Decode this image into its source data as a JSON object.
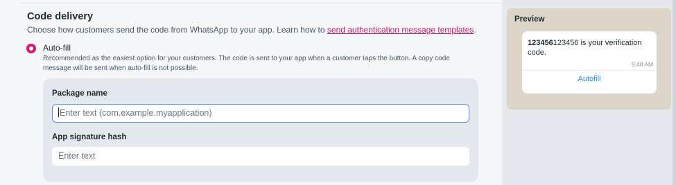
{
  "section": {
    "title": "Code delivery",
    "desc_prefix": "Choose how customers send the code from WhatsApp to your app. Learn how to ",
    "desc_link": "send authentication message templates",
    "desc_suffix": "."
  },
  "option": {
    "label": "Auto-fill",
    "selected": true,
    "description": "Recommended as the easiest option for your customers. The code is sent to your app when a customer taps the button. A copy code message will be sent when auto-fill is not possible."
  },
  "fields": {
    "package_name": {
      "label": "Package name",
      "value": "",
      "placeholder": "Enter text (com.example.myapplication)"
    },
    "signature_hash": {
      "label": "App signature hash",
      "value": "",
      "placeholder": "Enter text"
    }
  },
  "preview": {
    "title": "Preview",
    "code": "123456",
    "message_rest": "123456 is your verification code.",
    "time": "9:48 AM",
    "button_label": "Autofill"
  },
  "colors": {
    "accent": "#d6166f",
    "link_blue": "#1f8ed6",
    "panel_bg": "#e4e8ef"
  }
}
